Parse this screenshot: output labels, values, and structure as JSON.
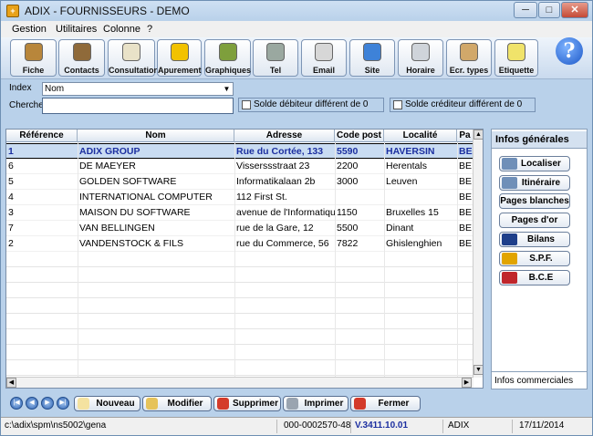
{
  "window": {
    "title": "ADIX - FOURNISSEURS - DEMO",
    "minimize": "─",
    "maximize": "□",
    "close": "✕"
  },
  "menu": [
    "Gestion",
    "Utilitaires",
    "Colonne",
    "?"
  ],
  "toolbar": [
    {
      "label": "Fiche",
      "icon": "person-card-icon",
      "color": "#b8863b"
    },
    {
      "label": "Contacts",
      "icon": "contacts-icon",
      "color": "#8f6a3a"
    },
    {
      "label": "Consultation",
      "icon": "open-book-icon",
      "color": "#e9e2c8"
    },
    {
      "label": "Apurement",
      "icon": "pencil-circle-icon",
      "color": "#f2c200"
    },
    {
      "label": "Graphiques",
      "icon": "pie-chart-icon",
      "color": "#7e9f3c"
    },
    {
      "label": "Tel",
      "icon": "phone-icon",
      "color": "#9aa8a0"
    },
    {
      "label": "Email",
      "icon": "email-at-icon",
      "color": "#d7d7d7"
    },
    {
      "label": "Site",
      "icon": "website-com-icon",
      "color": "#3e82d8"
    },
    {
      "label": "Horaire",
      "icon": "stopwatch-icon",
      "color": "#cfd4da"
    },
    {
      "label": "Ecr. types",
      "icon": "clipboard-icon",
      "color": "#d1a86a"
    },
    {
      "label": "Etiquette",
      "icon": "label-sheet-icon",
      "color": "#f0e36a"
    }
  ],
  "search": {
    "index_label": "Index",
    "index_value": "Nom",
    "cherche_label": "Cherche",
    "cherche_value": "",
    "debit_label": "Solde débiteur différent de 0",
    "credit_label": "Solde créditeur différent de 0"
  },
  "grid": {
    "headers": [
      "Référence",
      "Nom",
      "Adresse",
      "Code post",
      "Localité",
      "Pa"
    ],
    "rows": [
      [
        "1",
        "ADIX GROUP",
        "Rue du Cortée, 133",
        "5590",
        "HAVERSIN",
        "BE"
      ],
      [
        "6",
        "DE MAEYER",
        "Visserssstraat 23",
        "2200",
        "Herentals",
        "BE"
      ],
      [
        "5",
        "GOLDEN SOFTWARE",
        "Informatikalaan 2b",
        "3000",
        "Leuven",
        "BE"
      ],
      [
        "4",
        "INTERNATIONAL COMPUTER",
        "112 First St.",
        "",
        "",
        "BE"
      ],
      [
        "3",
        "MAISON DU SOFTWARE",
        "avenue de l'Informatiqu",
        "1150",
        "Bruxelles 15",
        "BE"
      ],
      [
        "7",
        "VAN BELLINGEN",
        "rue de la Gare, 12",
        "5500",
        "Dinant",
        "BE"
      ],
      [
        "2",
        "VANDENSTOCK & FILS",
        "rue du Commerce, 56",
        "7822",
        "Ghislenghien",
        "BE"
      ]
    ]
  },
  "side": {
    "header": "Infos générales",
    "buttons": [
      {
        "label": "Localiser",
        "icon": "map-locate-icon",
        "color": "#6f8fb8"
      },
      {
        "label": "Itinéraire",
        "icon": "route-car-icon",
        "color": "#6f8fb8"
      },
      {
        "label": "Pages blanches",
        "icon": "",
        "color": ""
      },
      {
        "label": "Pages d'or",
        "icon": "",
        "color": ""
      },
      {
        "label": "Bilans",
        "icon": "nbb-logo-icon",
        "color": "#1e3f8a"
      },
      {
        "label": "S.P.F.",
        "icon": "be-logo-icon",
        "color": "#e1a400"
      },
      {
        "label": "B.C.E",
        "icon": "bce-logo-icon",
        "color": "#c0262b"
      }
    ],
    "footer": "Infos commerciales"
  },
  "actions": [
    {
      "label": "Nouveau",
      "icon": "new-doc-icon",
      "color": "#f4e2a0"
    },
    {
      "label": "Modifier",
      "icon": "edit-pencil-icon",
      "color": "#e6c35a"
    },
    {
      "label": "Supprimer",
      "icon": "delete-x-icon",
      "color": "#d43b2a"
    },
    {
      "label": "Imprimer",
      "icon": "printer-icon",
      "color": "#9aa4b0"
    },
    {
      "label": "Fermer",
      "icon": "close-circle-icon",
      "color": "#d33a2a"
    }
  ],
  "nav_glyphs": [
    "|◀",
    "◀",
    "▶",
    "▶|"
  ],
  "status": {
    "path": "c:\\adix\\spm\\ns5002\\gena",
    "code": "000-0002570-48",
    "version": "V.3411.10.01",
    "company": "ADIX",
    "date": "17/11/2014"
  }
}
